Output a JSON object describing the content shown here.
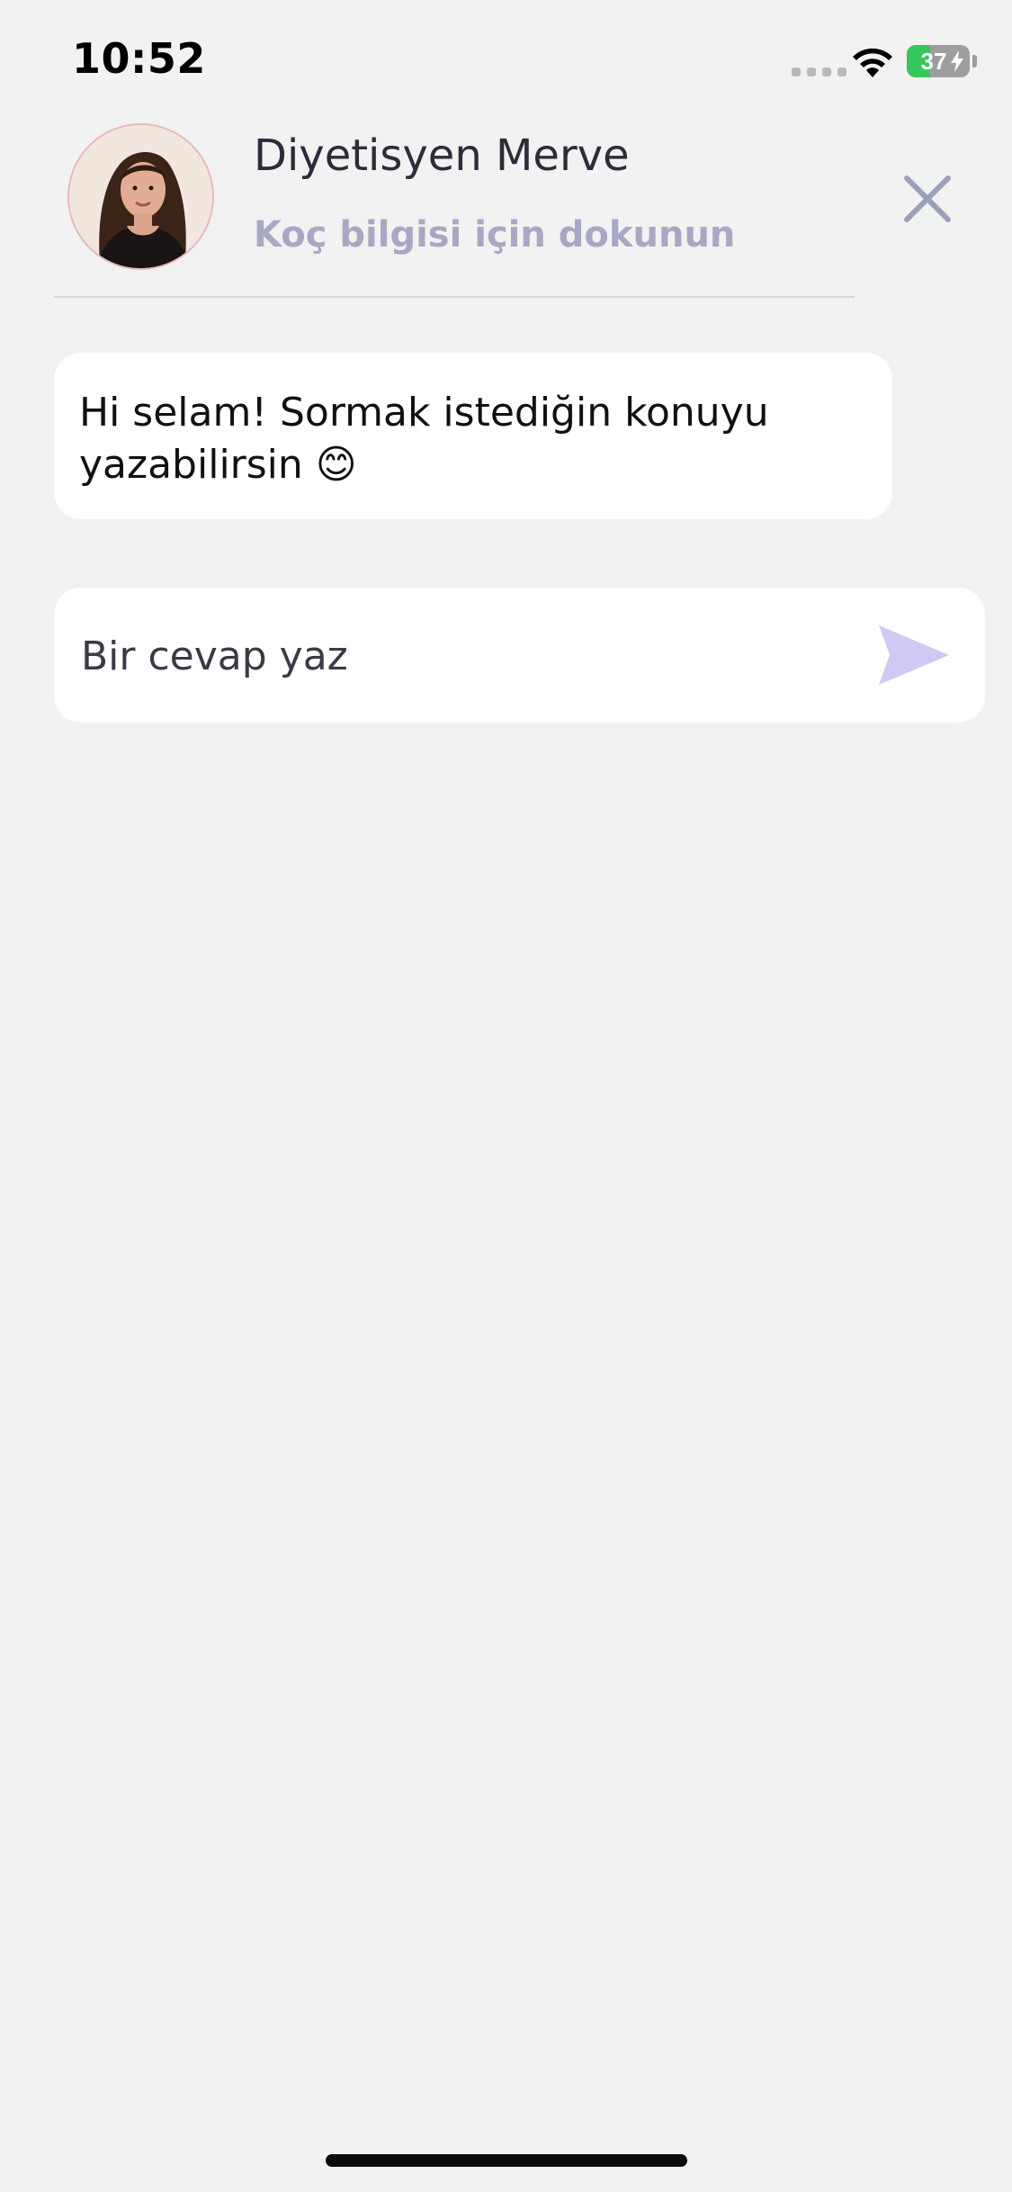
{
  "status_bar": {
    "time": "10:52",
    "battery_percent": "37",
    "battery_level": 0.37
  },
  "header": {
    "coach_name": "Diyetisyen Merve",
    "coach_hint": "Koç bilgisi için dokunun",
    "close_icon": "close-icon",
    "avatar": "coach-avatar"
  },
  "messages": [
    {
      "line1": "Hi selam! Sormak istediğin konuyu",
      "line2": "yazabilirsin 😊"
    }
  ],
  "reply": {
    "placeholder": "Bir cevap yaz",
    "value": "",
    "send_icon": "send-icon"
  },
  "colors": {
    "background": "#f2f2f2",
    "accent": "#cfcaf3",
    "subtitle": "#a9a8c4"
  }
}
